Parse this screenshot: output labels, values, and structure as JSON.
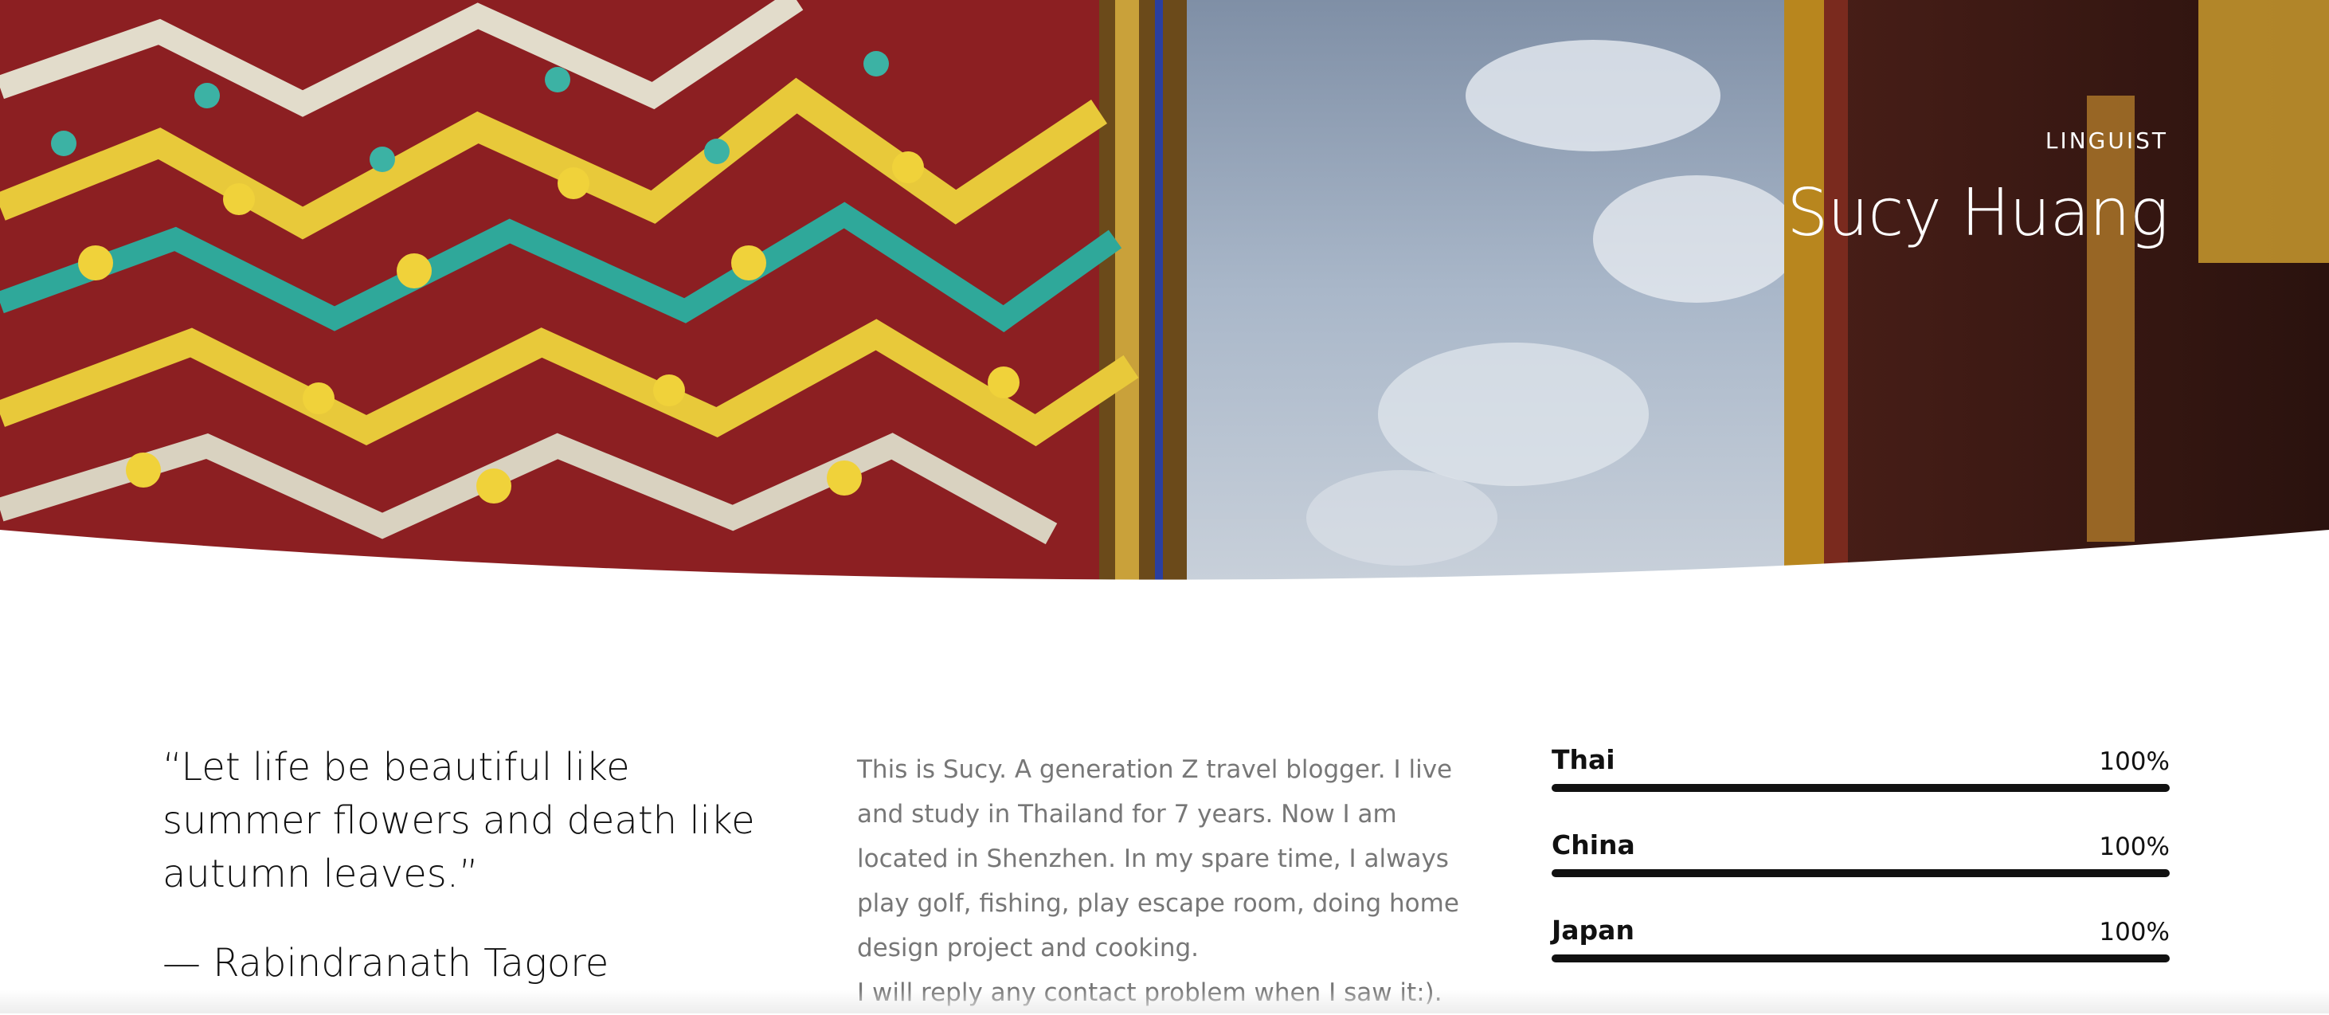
{
  "hero": {
    "eyebrow": "LINGUIST",
    "name": "Sucy Huang",
    "image": "temple-roof-and-sky-photo"
  },
  "quote": {
    "text": "“Let life be beautiful like summer flowers and death like autumn leaves.”",
    "author": "— Rabindranath Tagore"
  },
  "bio": {
    "paragraph1": "This is Sucy. A generation Z travel blogger. I live and study in Thailand for 7 years. Now I am located in Shenzhen. In my spare time, I always play golf, fishing, play escape room, doing home design project and cooking.",
    "paragraph2": "I will reply any contact problem when I saw it:)."
  },
  "skills": [
    {
      "label": "Thai",
      "percent_label": "100%",
      "level": 1.0
    },
    {
      "label": "China",
      "percent_label": "100%",
      "level": 1.0
    },
    {
      "label": "Japan",
      "percent_label": "100%",
      "level": 1.0
    }
  ],
  "colors": {
    "text_dark": "#111111",
    "text_muted": "#777777",
    "bar": "#111111",
    "background": "#ffffff"
  }
}
